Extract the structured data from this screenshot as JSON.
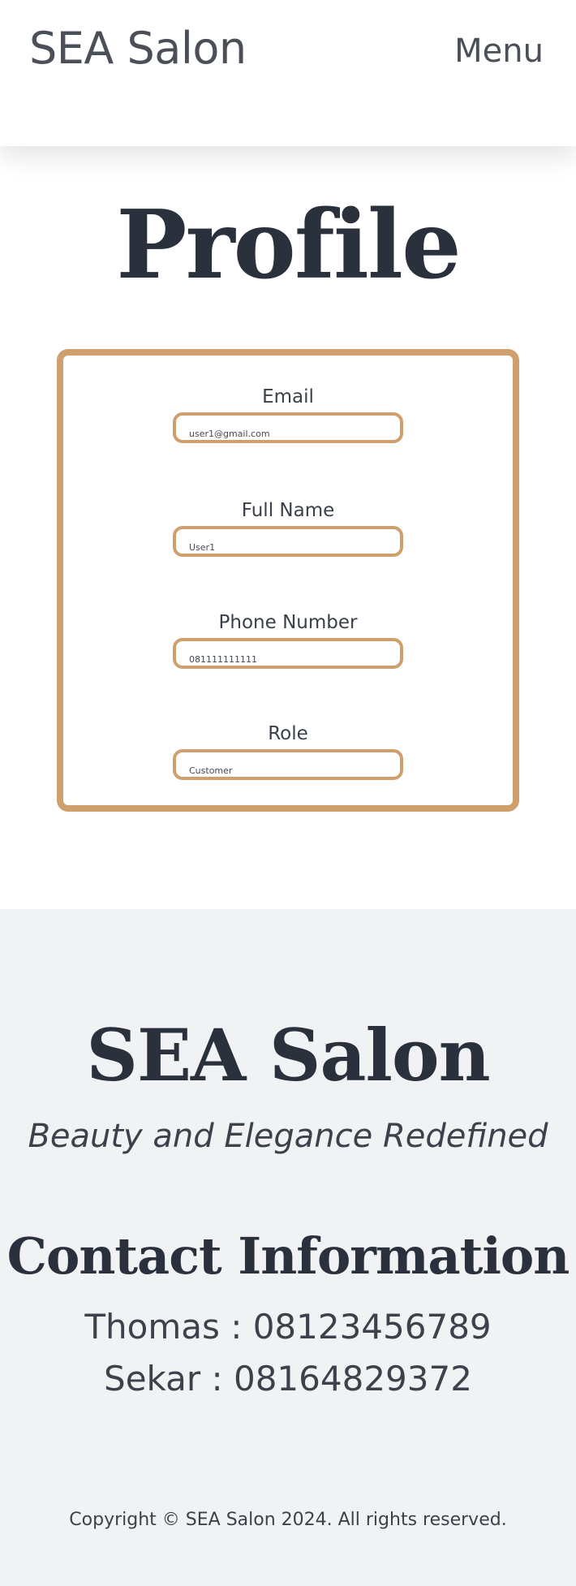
{
  "header": {
    "brand": "SEA Salon",
    "menu_label": "Menu"
  },
  "main": {
    "title": "Profile",
    "fields": [
      {
        "label": "Email",
        "value": "user1@gmail.com"
      },
      {
        "label": "Full Name",
        "value": "User1"
      },
      {
        "label": "Phone Number",
        "value": "081111111111"
      },
      {
        "label": "Role",
        "value": "Customer"
      }
    ]
  },
  "footer": {
    "brand": "SEA Salon",
    "tagline": "Beauty and Elegance Redefined",
    "contact_title": "Contact Information",
    "contacts": [
      "Thomas : 08123456789",
      "Sekar : 08164829372"
    ],
    "copyright": "Copyright © SEA Salon 2024. All rights reserved."
  },
  "colors": {
    "accent": "#cf9f6d",
    "text_dark": "#2a313c",
    "footer_bg": "#f1f2f4"
  }
}
